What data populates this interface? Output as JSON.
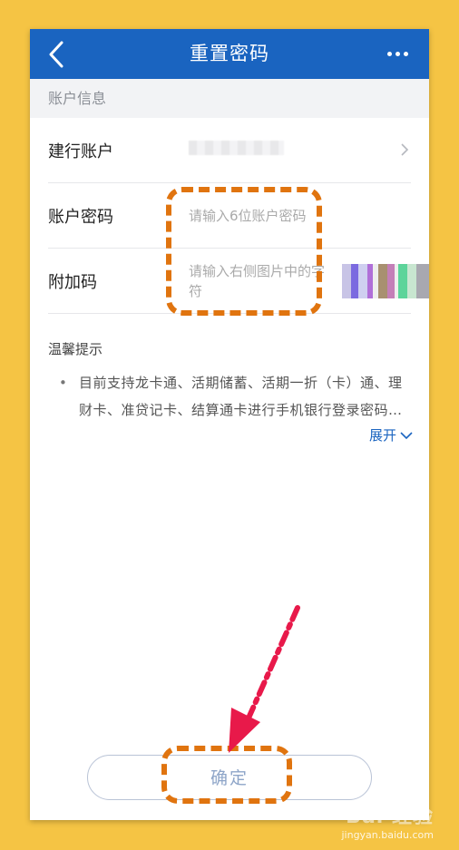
{
  "navbar": {
    "title": "重置密码",
    "back_icon": "chevron-left-icon",
    "more_icon": "more-dots-icon"
  },
  "section": {
    "header": "账户信息"
  },
  "form": {
    "account": {
      "label": "建行账户"
    },
    "password": {
      "label": "账户密码",
      "placeholder": "请输入6位账户密码"
    },
    "captcha": {
      "label": "附加码",
      "placeholder": "请输入右侧图片中的字符"
    }
  },
  "tips": {
    "title": "温馨提示",
    "bullet": "•",
    "text": "目前支持龙卡通、活期储蓄、活期一折（卡）通、理财卡、准贷记卡、结算通卡进行手机银行登录密码…",
    "expand_label": "展开"
  },
  "actions": {
    "confirm_label": "确定"
  },
  "colors": {
    "navbar_bg": "#1a64c0",
    "page_bg": "#f5c444",
    "annotation_orange": "#e0740f",
    "annotation_arrow": "#e8194a",
    "link": "#1a64c0"
  },
  "watermark": {
    "logo": "Bai 经验",
    "url": "jingyan.baidu.com"
  }
}
